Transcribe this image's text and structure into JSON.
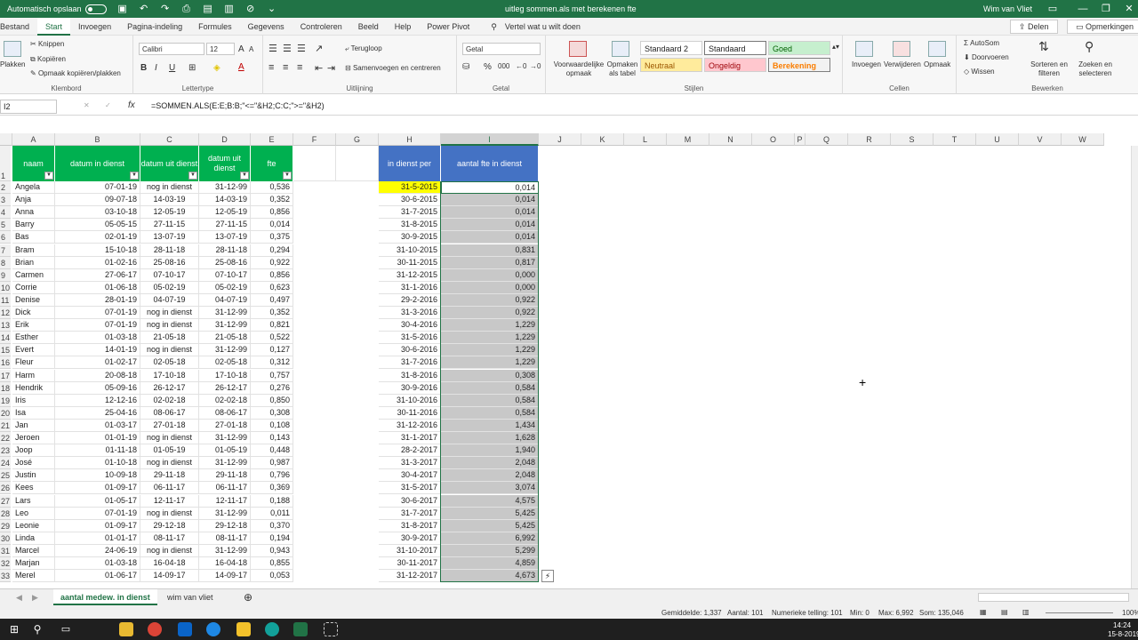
{
  "titlebar": {
    "autosave_label": "Automatisch opslaan",
    "doc_title": "uitleg sommen.als met berekenen fte",
    "user": "Wim van Vliet"
  },
  "tabs": [
    "Bestand",
    "Start",
    "Invoegen",
    "Pagina-indeling",
    "Formules",
    "Gegevens",
    "Controleren",
    "Beeld",
    "Help",
    "Power Pivot"
  ],
  "search_placeholder": "Vertel wat u wilt doen",
  "share": "Delen",
  "comments": "Opmerkingen",
  "ribbon": {
    "clipboard": {
      "paste": "Plakken",
      "cut": "Knippen",
      "copy": "Kopiëren",
      "format_painter": "Opmaak kopiëren/plakken",
      "label": "Klembord"
    },
    "font": {
      "name": "Calibri",
      "size": "12",
      "bold": "B",
      "italic": "I",
      "underline": "U",
      "label": "Lettertype"
    },
    "alignment": {
      "wrap": "Terugloop",
      "merge": "Samenvoegen en centreren",
      "label": "Uitlijning"
    },
    "number": {
      "format": "Getal",
      "label": "Getal"
    },
    "styles": {
      "cond": "Voorwaardelijke opmaak",
      "table": "Opmaken als tabel",
      "s2": "Standaard 2",
      "std": "Standaard",
      "good": "Goed",
      "neutral": "Neutraal",
      "bad": "Ongeldig",
      "calc": "Berekening",
      "label": "Stijlen"
    },
    "cells": {
      "insert": "Invoegen",
      "delete": "Verwijderen",
      "format": "Opmaak",
      "label": "Cellen"
    },
    "editing": {
      "autosum": "AutoSom",
      "fill": "Doorvoeren",
      "clear": "Wissen",
      "sort": "Sorteren en filteren",
      "find": "Zoeken en selecteren",
      "label": "Bewerken"
    }
  },
  "namebox": "I2",
  "formula": "=SOMMEN.ALS(E:E;B:B;\"<=\"&H2;C:C;\">=\"&H2)",
  "columns": [
    "A",
    "B",
    "C",
    "D",
    "E",
    "F",
    "G",
    "H",
    "I",
    "J",
    "K",
    "L",
    "M",
    "N",
    "O",
    "P",
    "Q",
    "R",
    "S",
    "T",
    "U",
    "V",
    "W"
  ],
  "headers": {
    "naam": "naam",
    "in": "datum in dienst",
    "uit1": "datum uit dienst",
    "uit2": "datum uit dienst",
    "fte": "fte",
    "per": "in dienst per",
    "aantal": "aantal fte in dienst"
  },
  "rows": [
    [
      "Angela",
      "07-01-19",
      "nog in dienst",
      "31-12-99",
      "0,536",
      "31-5-2015",
      "0,014"
    ],
    [
      "Anja",
      "09-07-18",
      "14-03-19",
      "14-03-19",
      "0,352",
      "30-6-2015",
      "0,014"
    ],
    [
      "Anna",
      "03-10-18",
      "12-05-19",
      "12-05-19",
      "0,856",
      "31-7-2015",
      "0,014"
    ],
    [
      "Barry",
      "05-05-15",
      "27-11-15",
      "27-11-15",
      "0,014",
      "31-8-2015",
      "0,014"
    ],
    [
      "Bas",
      "02-01-19",
      "13-07-19",
      "13-07-19",
      "0,375",
      "30-9-2015",
      "0,014"
    ],
    [
      "Bram",
      "15-10-18",
      "28-11-18",
      "28-11-18",
      "0,294",
      "31-10-2015",
      "0,831"
    ],
    [
      "Brian",
      "01-02-16",
      "25-08-16",
      "25-08-16",
      "0,922",
      "30-11-2015",
      "0,817"
    ],
    [
      "Carmen",
      "27-06-17",
      "07-10-17",
      "07-10-17",
      "0,856",
      "31-12-2015",
      "0,000"
    ],
    [
      "Corrie",
      "01-06-18",
      "05-02-19",
      "05-02-19",
      "0,623",
      "31-1-2016",
      "0,000"
    ],
    [
      "Denise",
      "28-01-19",
      "04-07-19",
      "04-07-19",
      "0,497",
      "29-2-2016",
      "0,922"
    ],
    [
      "Dick",
      "07-01-19",
      "nog in dienst",
      "31-12-99",
      "0,352",
      "31-3-2016",
      "0,922"
    ],
    [
      "Erik",
      "07-01-19",
      "nog in dienst",
      "31-12-99",
      "0,821",
      "30-4-2016",
      "1,229"
    ],
    [
      "Esther",
      "01-03-18",
      "21-05-18",
      "21-05-18",
      "0,522",
      "31-5-2016",
      "1,229"
    ],
    [
      "Evert",
      "14-01-19",
      "nog in dienst",
      "31-12-99",
      "0,127",
      "30-6-2016",
      "1,229"
    ],
    [
      "Fleur",
      "01-02-17",
      "02-05-18",
      "02-05-18",
      "0,312",
      "31-7-2016",
      "1,229"
    ],
    [
      "Harm",
      "20-08-18",
      "17-10-18",
      "17-10-18",
      "0,757",
      "31-8-2016",
      "0,308"
    ],
    [
      "Hendrik",
      "05-09-16",
      "26-12-17",
      "26-12-17",
      "0,276",
      "30-9-2016",
      "0,584"
    ],
    [
      "Iris",
      "12-12-16",
      "02-02-18",
      "02-02-18",
      "0,850",
      "31-10-2016",
      "0,584"
    ],
    [
      "Isa",
      "25-04-16",
      "08-06-17",
      "08-06-17",
      "0,308",
      "30-11-2016",
      "0,584"
    ],
    [
      "Jan",
      "01-03-17",
      "27-01-18",
      "27-01-18",
      "0,108",
      "31-12-2016",
      "1,434"
    ],
    [
      "Jeroen",
      "01-01-19",
      "nog in dienst",
      "31-12-99",
      "0,143",
      "31-1-2017",
      "1,628"
    ],
    [
      "Joop",
      "01-11-18",
      "01-05-19",
      "01-05-19",
      "0,448",
      "28-2-2017",
      "1,940"
    ],
    [
      "José",
      "01-10-18",
      "nog in dienst",
      "31-12-99",
      "0,987",
      "31-3-2017",
      "2,048"
    ],
    [
      "Justin",
      "10-09-18",
      "29-11-18",
      "29-11-18",
      "0,796",
      "30-4-2017",
      "2,048"
    ],
    [
      "Kees",
      "01-09-17",
      "06-11-17",
      "06-11-17",
      "0,369",
      "31-5-2017",
      "3,074"
    ],
    [
      "Lars",
      "01-05-17",
      "12-11-17",
      "12-11-17",
      "0,188",
      "30-6-2017",
      "4,575"
    ],
    [
      "Leo",
      "07-01-19",
      "nog in dienst",
      "31-12-99",
      "0,011",
      "31-7-2017",
      "5,425"
    ],
    [
      "Leonie",
      "01-09-17",
      "29-12-18",
      "29-12-18",
      "0,370",
      "31-8-2017",
      "5,425"
    ],
    [
      "Linda",
      "01-01-17",
      "08-11-17",
      "08-11-17",
      "0,194",
      "30-9-2017",
      "6,992"
    ],
    [
      "Marcel",
      "24-06-19",
      "nog in dienst",
      "31-12-99",
      "0,943",
      "31-10-2017",
      "5,299"
    ],
    [
      "Marjan",
      "01-03-18",
      "16-04-18",
      "16-04-18",
      "0,855",
      "30-11-2017",
      "4,859"
    ],
    [
      "Merel",
      "01-06-17",
      "14-09-17",
      "14-09-17",
      "0,053",
      "31-12-2017",
      "4,673"
    ]
  ],
  "sheets": [
    "aantal medew. in dienst",
    "wim van vliet"
  ],
  "status": {
    "avg": "Gemiddelde: 1,337",
    "count": "Aantal: 101",
    "numcount": "Numerieke telling: 101",
    "min": "Min: 0",
    "max": "Max: 6,992",
    "sum": "Som: 135,046",
    "zoom": "100%"
  },
  "clock": {
    "time": "14:24",
    "date": "15-8-2019"
  },
  "colors": {
    "green": "#00b050",
    "blue": "#4472c4",
    "yellow": "#ffff00",
    "selgray": "#c8c8c8",
    "excel": "#217346"
  }
}
